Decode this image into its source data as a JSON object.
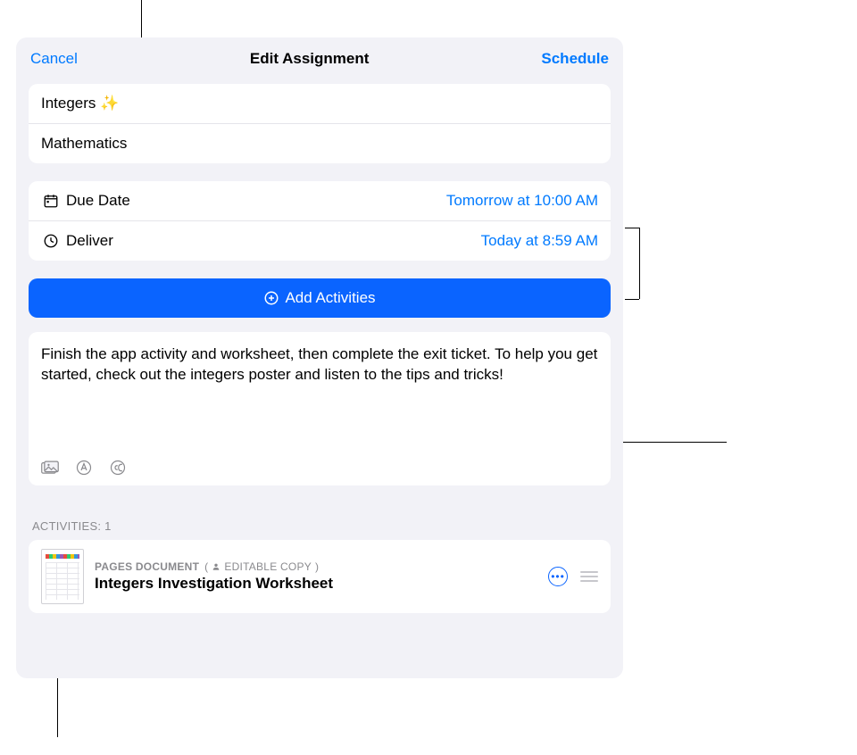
{
  "navbar": {
    "cancel": "Cancel",
    "title": "Edit Assignment",
    "schedule": "Schedule"
  },
  "title_card": {
    "title": "Integers ✨",
    "class": "Mathematics"
  },
  "dates": {
    "due_label": "Due Date",
    "due_value": "Tomorrow at 10:00 AM",
    "deliver_label": "Deliver",
    "deliver_value": "Today at 8:59 AM"
  },
  "add_activities_label": "Add Activities",
  "instructions": "Finish the app activity and worksheet, then complete the exit ticket. To help you get started, check out the integers poster and listen to the tips and tricks!",
  "activities": {
    "header": "ACTIVITIES: 1",
    "items": [
      {
        "type_label": "PAGES DOCUMENT",
        "badge": "EDITABLE COPY",
        "title": "Integers Investigation Worksheet"
      }
    ]
  }
}
